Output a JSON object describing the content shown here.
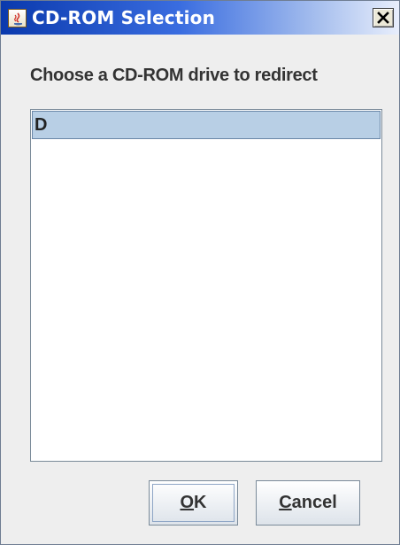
{
  "window": {
    "title": "CD-ROM Selection",
    "icon": "java-cup-icon",
    "close_icon": "close-x-icon"
  },
  "prompt": "Choose a CD-ROM drive to redirect",
  "drives": [
    {
      "label": "D",
      "selected": true
    }
  ],
  "buttons": {
    "ok": {
      "mnemonic": "O",
      "rest": "K"
    },
    "cancel": {
      "mnemonic": "C",
      "rest": "ancel"
    }
  },
  "colors": {
    "selection": "#b8cfe5",
    "titlebar_start": "#0a39ad",
    "titlebar_end": "#e8eefc"
  }
}
